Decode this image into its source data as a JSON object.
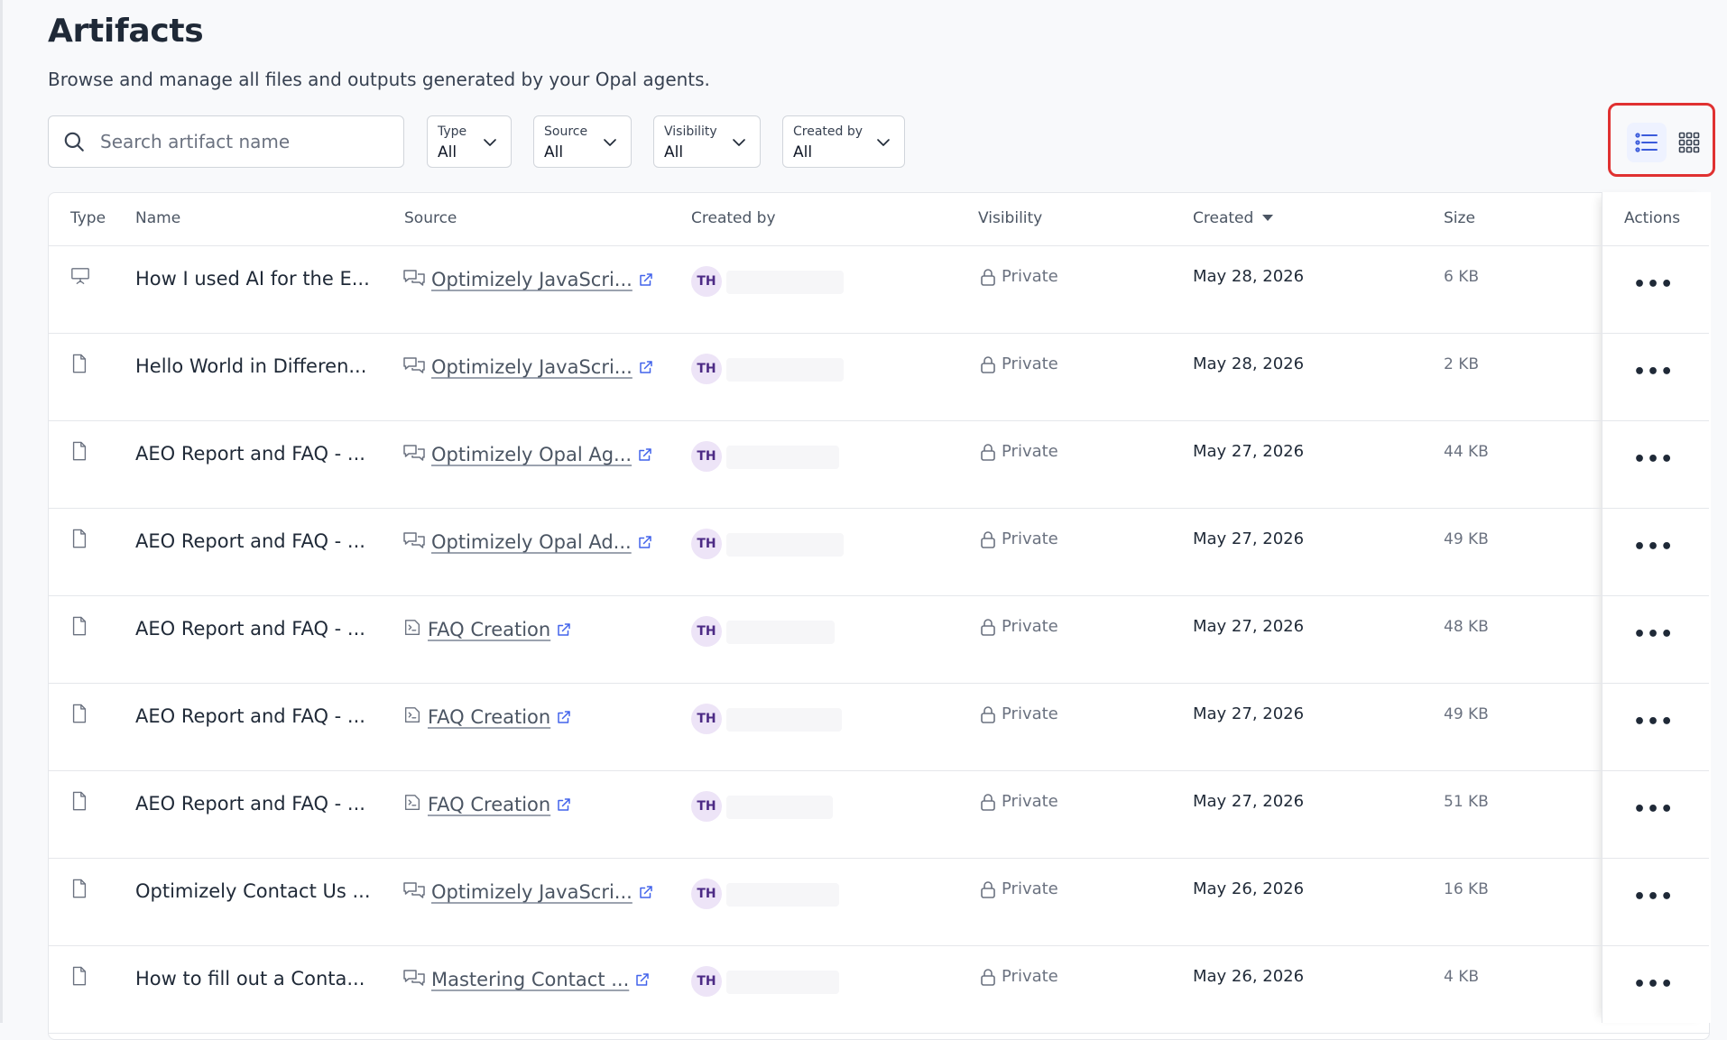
{
  "page": {
    "title": "Artifacts",
    "subtitle": "Browse and manage all files and outputs generated by your Opal agents."
  },
  "search": {
    "placeholder": "Search artifact name"
  },
  "filters": [
    {
      "label": "Type",
      "value": "All"
    },
    {
      "label": "Source",
      "value": "All"
    },
    {
      "label": "Visibility",
      "value": "All"
    },
    {
      "label": "Created by",
      "value": "All"
    }
  ],
  "view_toggle": {
    "active": "list",
    "options": [
      "list-view-icon",
      "grid-view-icon"
    ],
    "highlight_color": "#e03131"
  },
  "table": {
    "headers": {
      "type": "Type",
      "name": "Name",
      "source": "Source",
      "created_by": "Created by",
      "visibility": "Visibility",
      "created": "Created",
      "size": "Size",
      "actions": "Actions"
    },
    "sorted_by": "created",
    "sort_direction": "desc",
    "rows": [
      {
        "type_icon": "presentation-icon",
        "name": "How I used AI for the E...",
        "source_icon": "chat-icon",
        "source": "Optimizely JavaScri...",
        "avatar": "TH",
        "visibility": "Private",
        "created": "May 28, 2026",
        "size": "6 KB",
        "actions": "•••"
      },
      {
        "type_icon": "document-icon",
        "name": "Hello World in Differen...",
        "source_icon": "chat-icon",
        "source": "Optimizely JavaScri...",
        "avatar": "TH",
        "visibility": "Private",
        "created": "May 28, 2026",
        "size": "2 KB",
        "actions": "•••"
      },
      {
        "type_icon": "document-icon",
        "name": "AEO Report and FAQ - ...",
        "source_icon": "chat-icon",
        "source": "Optimizely Opal Ag...",
        "avatar": "TH",
        "visibility": "Private",
        "created": "May 27, 2026",
        "size": "44 KB",
        "actions": "•••"
      },
      {
        "type_icon": "document-icon",
        "name": "AEO Report and FAQ - ...",
        "source_icon": "chat-icon",
        "source": "Optimizely Opal Ad...",
        "avatar": "TH",
        "visibility": "Private",
        "created": "May 27, 2026",
        "size": "49 KB",
        "actions": "•••"
      },
      {
        "type_icon": "document-icon",
        "name": "AEO Report and FAQ - ...",
        "source_icon": "workflow-icon",
        "source": "FAQ Creation",
        "avatar": "TH",
        "visibility": "Private",
        "created": "May 27, 2026",
        "size": "48 KB",
        "actions": "•••"
      },
      {
        "type_icon": "document-icon",
        "name": "AEO Report and FAQ - ...",
        "source_icon": "workflow-icon",
        "source": "FAQ Creation",
        "avatar": "TH",
        "visibility": "Private",
        "created": "May 27, 2026",
        "size": "49 KB",
        "actions": "•••"
      },
      {
        "type_icon": "document-icon",
        "name": "AEO Report and FAQ - ...",
        "source_icon": "workflow-icon",
        "source": "FAQ Creation",
        "avatar": "TH",
        "visibility": "Private",
        "created": "May 27, 2026",
        "size": "51 KB",
        "actions": "•••"
      },
      {
        "type_icon": "document-icon",
        "name": "Optimizely Contact Us ...",
        "source_icon": "chat-icon",
        "source": "Optimizely JavaScri...",
        "avatar": "TH",
        "visibility": "Private",
        "created": "May 26, 2026",
        "size": "16 KB",
        "actions": "•••"
      },
      {
        "type_icon": "document-icon",
        "name": "How to fill out a Conta...",
        "source_icon": "chat-icon",
        "source": "Mastering Contact ...",
        "avatar": "TH",
        "visibility": "Private",
        "created": "May 26, 2026",
        "size": "4 KB",
        "actions": "•••"
      }
    ]
  }
}
